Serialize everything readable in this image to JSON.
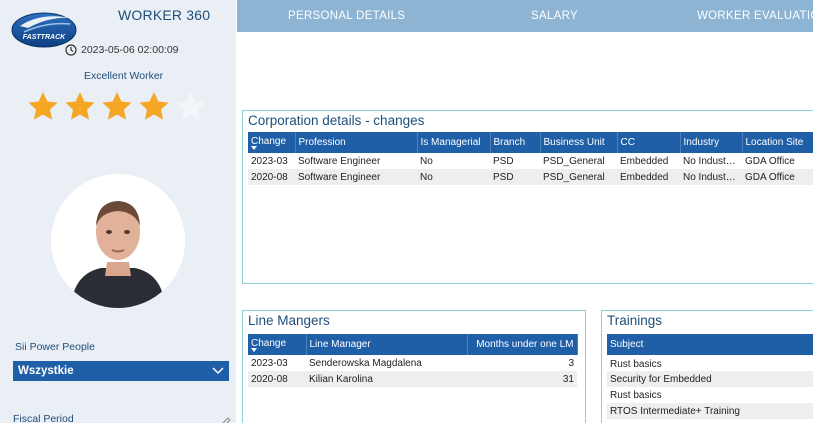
{
  "header": {
    "logo_text": "FASTTRACK",
    "worker_title": "WORKER 360",
    "timestamp": "2023-05-06 02:00:09",
    "rating_label": "Excellent Worker",
    "rating": {
      "filled": 4,
      "total": 5
    }
  },
  "sidebar": {
    "slicer_label": "Sii Power People",
    "slicer_value": "Wszystkie",
    "fiscal_label": "Fiscal Period"
  },
  "nav": {
    "tabs": [
      "PERSONAL DETAILS",
      "SALARY",
      "WORKER EVALUATIO"
    ]
  },
  "corporation": {
    "title": "Corporation details  - changes",
    "columns": [
      "Change",
      "Profession",
      "Is Managerial",
      "Branch",
      "Business Unit",
      "CC",
      "Industry",
      "Location Site"
    ],
    "rows": [
      [
        "2023-03",
        "Software Engineer",
        "No",
        "PSD",
        "PSD_General",
        "Embedded",
        "No Indust…",
        "GDA Office"
      ],
      [
        "2020-08",
        "Software Engineer",
        "No",
        "PSD",
        "PSD_General",
        "Embedded",
        "No Indust…",
        "GDA Office"
      ]
    ]
  },
  "line_managers": {
    "title": "Line Mangers",
    "columns": [
      "Change",
      "Line Manager",
      "Months under one LM"
    ],
    "rows": [
      [
        "2023-03",
        "Senderowska Magdalena",
        "3"
      ],
      [
        "2020-08",
        "Kilian Karolina",
        "31"
      ]
    ]
  },
  "trainings": {
    "title": "Trainings",
    "columns": [
      "Subject"
    ],
    "rows": [
      "Rust basics",
      "Security for Embedded",
      "Rust basics",
      "RTOS Intermediate+ Training"
    ]
  },
  "colors": {
    "sidebar_bg": "#eaeef5",
    "nav_bg": "#8eb4d4",
    "header_blue": "#1f5fa8",
    "title_blue": "#1f4e79",
    "star_fill": "#f5a623",
    "panel_border": "#8fd0d0"
  }
}
